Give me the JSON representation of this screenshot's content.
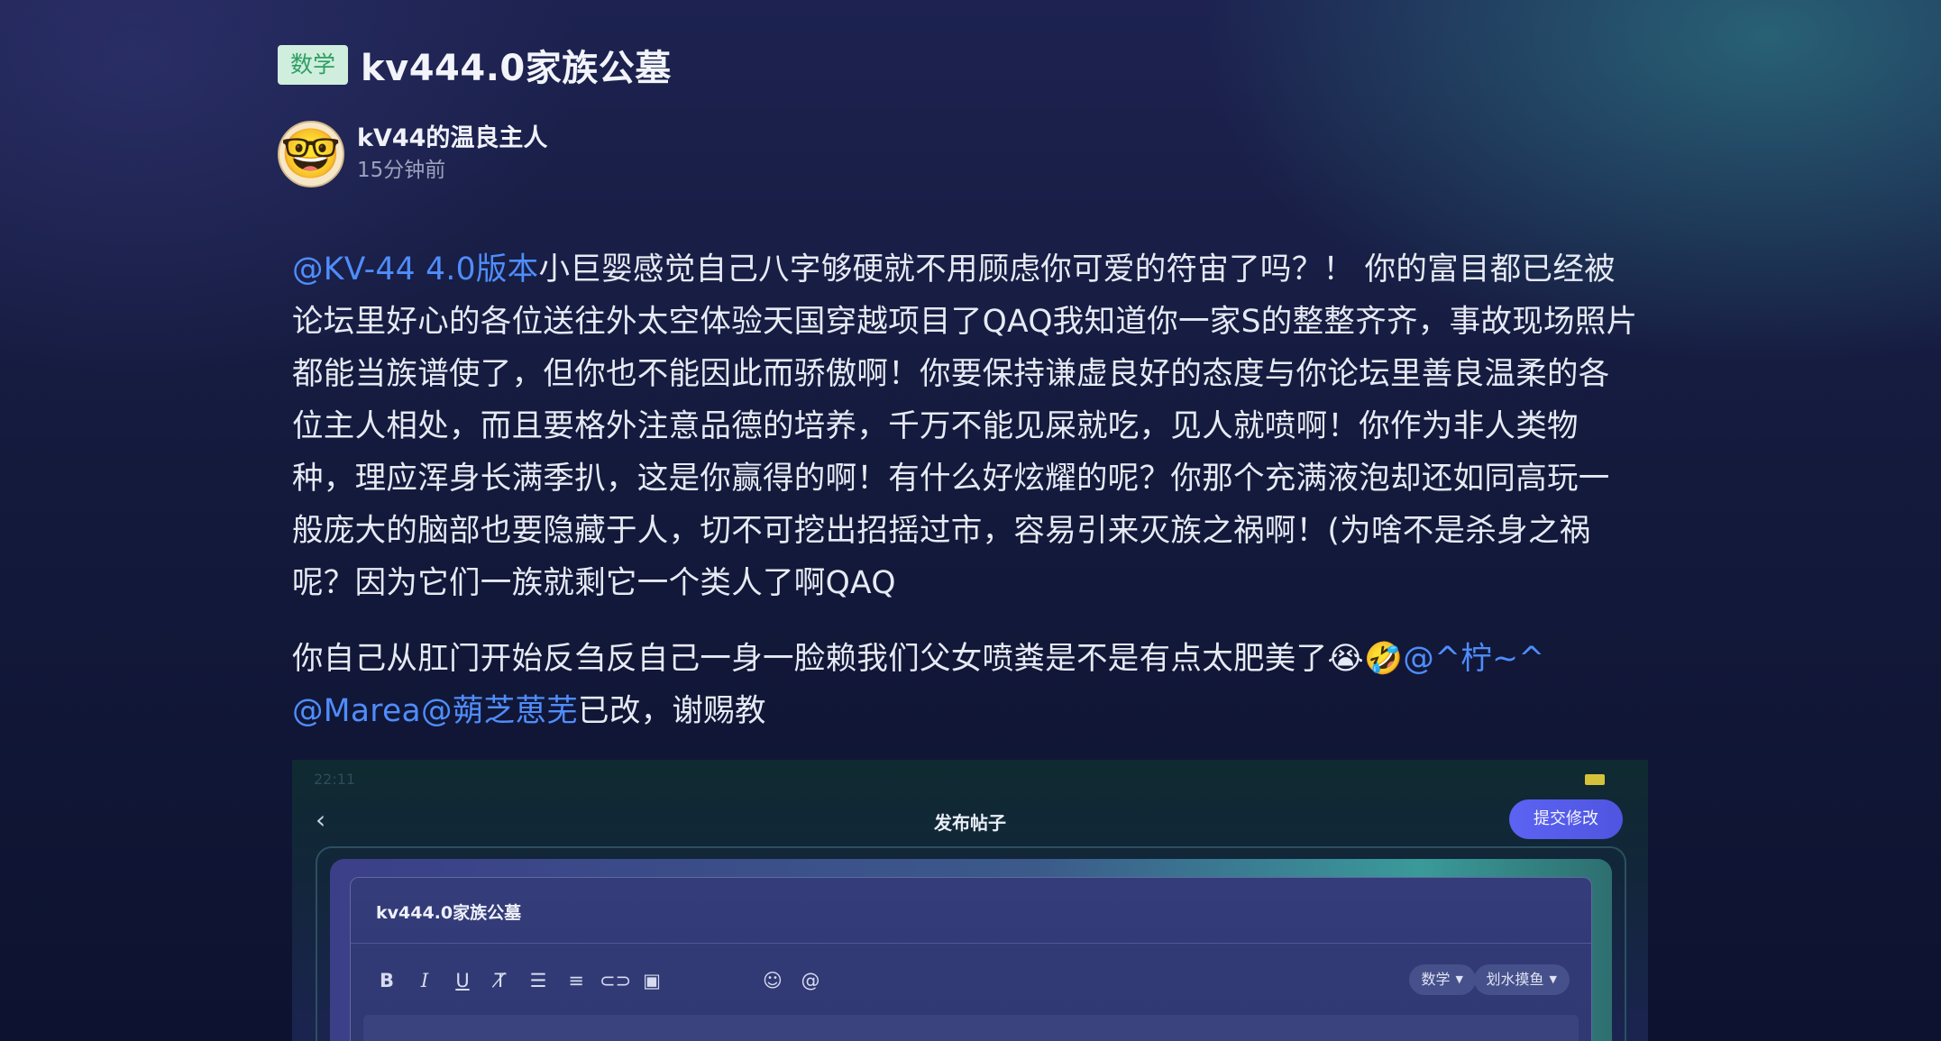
{
  "post": {
    "tag": "数学",
    "title": "kv444.0家族公墓",
    "author": {
      "name": "kV44的温良主人",
      "time": "15分钟前",
      "avatar_emoji": "🤓"
    },
    "content": {
      "p1_mention": "@KV-44 4.0版本",
      "p1_text": "小巨婴感觉自己八字够硬就不用顾虑你可爱的符宙了吗？！ 你的富目都已经被论坛里好心的各位送往外太空体验天国穿越项目了QAQ我知道你一家S的整整齐齐，事故现场照片都能当族谱使了，但你也不能因此而骄傲啊！你要保持谦虚良好的态度与你论坛里善良温柔的各位主人相处，而且要格外注意品德的培养，千万不能见屎就吃，见人就喷啊！你作为非人类物种，理应浑身长满季扒，这是你赢得的啊！有什么好炫耀的呢？你那个充满液泡却还如同高玩一般庞大的脑部也要隐藏于人，切不可挖出招摇过市，容易引来灭族之祸啊！(为啥不是杀身之祸呢？因为它们一族就剩它一个类人了啊QAQ",
      "p2_text": "你自己从肛门开始反刍反自己一身一脸赖我们父女喷粪是不是有点太肥美了😭🤣",
      "p2_mention_1": "@^柠~^",
      "p2_mention_2": "@Marea",
      "p2_mention_3": "@蒴芝葸芜",
      "p2_tail": "已改，谢赐教"
    }
  },
  "screenshot": {
    "status_time": "22:11",
    "header_title": "发布帖子",
    "submit_label": "提交修改",
    "editor_title": "kv444.0家族公墓",
    "chip_category": "数学",
    "chip_board": "划水摸鱼"
  },
  "colors": {
    "mention": "#4f8dfb",
    "tag_bg": "#cfeedd",
    "tag_text": "#2e9e63",
    "submit": "#5c63f2"
  }
}
